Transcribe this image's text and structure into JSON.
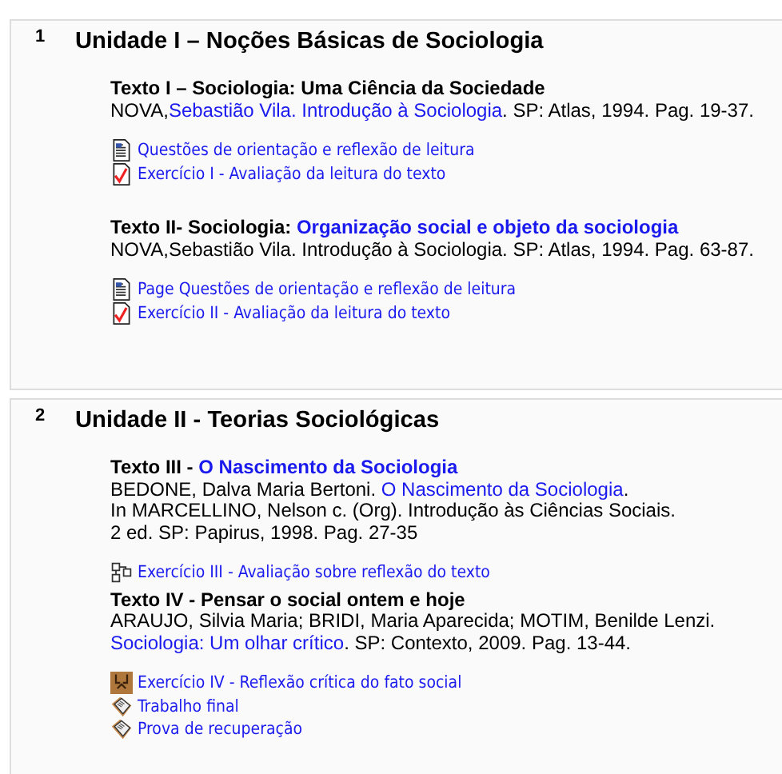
{
  "sections": [
    {
      "number": "1",
      "title": "Unidade I – Noções Básicas de Sociologia",
      "blocks": [
        {
          "kind": "reading",
          "heading": [
            {
              "text": "Texto I – Sociologia: Uma Ciência da Sociedade",
              "link": false
            }
          ],
          "lines": [
            [
              {
                "text": "NOVA,",
                "link": false
              },
              {
                "text": "Sebastião Vila. Introdução à Sociologia",
                "link": true
              },
              {
                "text": ". SP: Atlas, 1994. Pag. 19-37.",
                "link": false
              }
            ]
          ]
        },
        {
          "kind": "activities",
          "items": [
            {
              "kind": "page",
              "label": "Questões de orientação e reflexão de leitura"
            },
            {
              "kind": "check",
              "label": "Exercício I - Avaliação da leitura do texto"
            }
          ]
        },
        {
          "kind": "reading",
          "heading": [
            {
              "text": "Texto II- Sociologia:  ",
              "link": false
            },
            {
              "text": "Organização social e objeto da sociologia",
              "link": true
            }
          ],
          "lines": [
            [
              {
                "text": "NOVA,Sebastião Vila. Introdução à Sociologia. SP: Atlas, 1994. Pag. 63-87.",
                "link": false
              }
            ]
          ]
        },
        {
          "kind": "activities",
          "items": [
            {
              "kind": "page",
              "label": "Page Questões de orientação e reflexão de leitura"
            },
            {
              "kind": "check",
              "label": "Exercício II - Avaliação da leitura do texto"
            }
          ]
        }
      ]
    },
    {
      "number": "2",
      "title": "Unidade II - Teorias Sociológicas",
      "blocks": [
        {
          "kind": "reading",
          "heading": [
            {
              "text": "Texto III - ",
              "link": false
            },
            {
              "text": "O Nascimento da Sociologia",
              "link": true
            }
          ],
          "lines": [
            [
              {
                "text": "BEDONE, Dalva Maria Bertoni. ",
                "link": false
              },
              {
                "text": "O Nascimento da Sociologia",
                "link": true
              },
              {
                "text": ".",
                "link": false
              }
            ],
            [
              {
                "text": "In MARCELLINO, Nelson c. (Org). Introdução às Ciências Sociais.",
                "link": false
              }
            ],
            [
              {
                "text": "2 ed. SP: Papirus, 1998. Pag. 27-35",
                "link": false
              }
            ]
          ]
        },
        {
          "kind": "activities",
          "items": [
            {
              "kind": "squares",
              "label": "Exercício III - Avaliação sobre reflexão do texto"
            }
          ]
        },
        {
          "kind": "reading",
          "heading": [
            {
              "text": "Texto IV - Pensar o social ontem e hoje",
              "link": false
            }
          ],
          "lines": [
            [
              {
                "text": "ARAUJO, Silvia Maria; BRIDI, Maria Aparecida; MOTIM, Benilde Lenzi.",
                "link": false
              }
            ],
            [
              {
                "text": "Sociologia: Um olhar crítico",
                "link": true
              },
              {
                "text": ". SP: Contexto, 2009. Pag. 13-44.",
                "link": false
              }
            ]
          ]
        },
        {
          "kind": "activities",
          "items": [
            {
              "kind": "workshop",
              "label": "Exercício IV - Reflexão crítica do fato social"
            },
            {
              "kind": "assignment",
              "label": "Trabalho final"
            },
            {
              "kind": "assignment",
              "label": "Prova de recuperação"
            }
          ]
        }
      ]
    }
  ]
}
